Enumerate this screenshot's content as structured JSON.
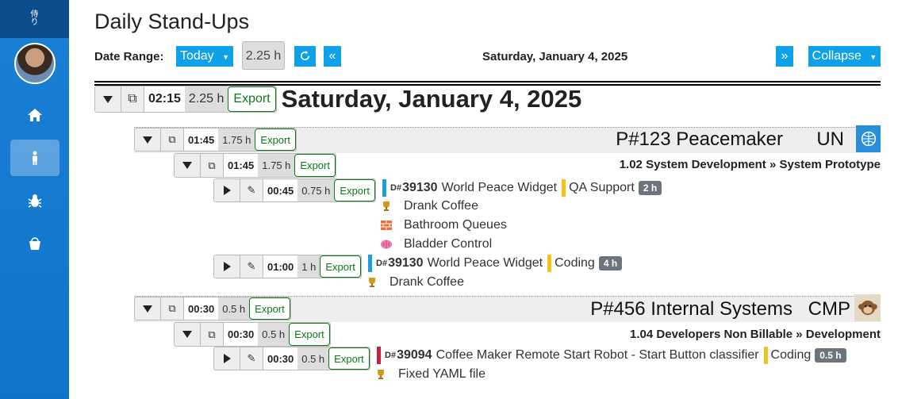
{
  "sidebar": {
    "logo_text": "侍\nり",
    "items": [
      {
        "icon": "home-icon",
        "active": false
      },
      {
        "icon": "person-icon",
        "active": true
      },
      {
        "icon": "bug-icon",
        "active": false
      },
      {
        "icon": "bucket-icon",
        "active": false
      }
    ]
  },
  "page": {
    "title": "Daily Stand-Ups"
  },
  "toolbar": {
    "date_range_label": "Date Range:",
    "today_label": "Today",
    "total_hours": "2.25 h",
    "prev_label": "«",
    "date": "Saturday, January 4, 2025",
    "next_label": "»",
    "collapse_label": "Collapse"
  },
  "day": {
    "time": "02:15",
    "hours": "2.25 h",
    "export": "Export",
    "title": "Saturday, January 4, 2025"
  },
  "projects": [
    {
      "time": "01:45",
      "hours": "1.75 h",
      "export": "Export",
      "title": "P#123 Peacemaker",
      "client": "UN",
      "task": {
        "time": "01:45",
        "hours": "1.75 h",
        "export": "Export",
        "title": "1.02 System Development » System Prototype"
      },
      "entries": [
        {
          "time": "00:45",
          "hours": "0.75 h",
          "export": "Export",
          "bar_color": "#1a9fd6",
          "d": "D#",
          "num": "39130",
          "name": "World Peace Widget",
          "type": "QA Support",
          "badge": "2 h",
          "notes": [
            {
              "icon": "trophy-icon",
              "text": "Drank Coffee"
            },
            {
              "icon": "brick-wall-icon",
              "text": "Bathroom Queues"
            },
            {
              "icon": "brain-icon",
              "text": "Bladder Control"
            }
          ]
        },
        {
          "time": "01:00",
          "hours": "1 h",
          "export": "Export",
          "bar_color": "#1a9fd6",
          "d": "D#",
          "num": "39130",
          "name": "World Peace Widget",
          "type": "Coding",
          "badge": "4 h",
          "notes": [
            {
              "icon": "trophy-icon",
              "text": "Drank Coffee"
            }
          ]
        }
      ]
    },
    {
      "time": "00:30",
      "hours": "0.5 h",
      "export": "Export",
      "title": "P#456 Internal Systems",
      "client": "CMP",
      "task": {
        "time": "00:30",
        "hours": "0.5 h",
        "export": "Export",
        "title": "1.04 Developers Non Billable » Development"
      },
      "entries": [
        {
          "time": "00:30",
          "hours": "0.5 h",
          "export": "Export",
          "bar_color": "#c9243f",
          "d": "D#",
          "num": "39094",
          "name": "Coffee Maker Remote Start Robot - Start Button classifier",
          "type": "Coding",
          "badge": "0.5 h",
          "notes": [
            {
              "icon": "trophy-icon",
              "text": "Fixed YAML file"
            }
          ]
        }
      ]
    }
  ],
  "colors": {
    "accent": "#0ea1ea",
    "export_green": "#0a7a16",
    "type_bar": "#f0c419"
  }
}
